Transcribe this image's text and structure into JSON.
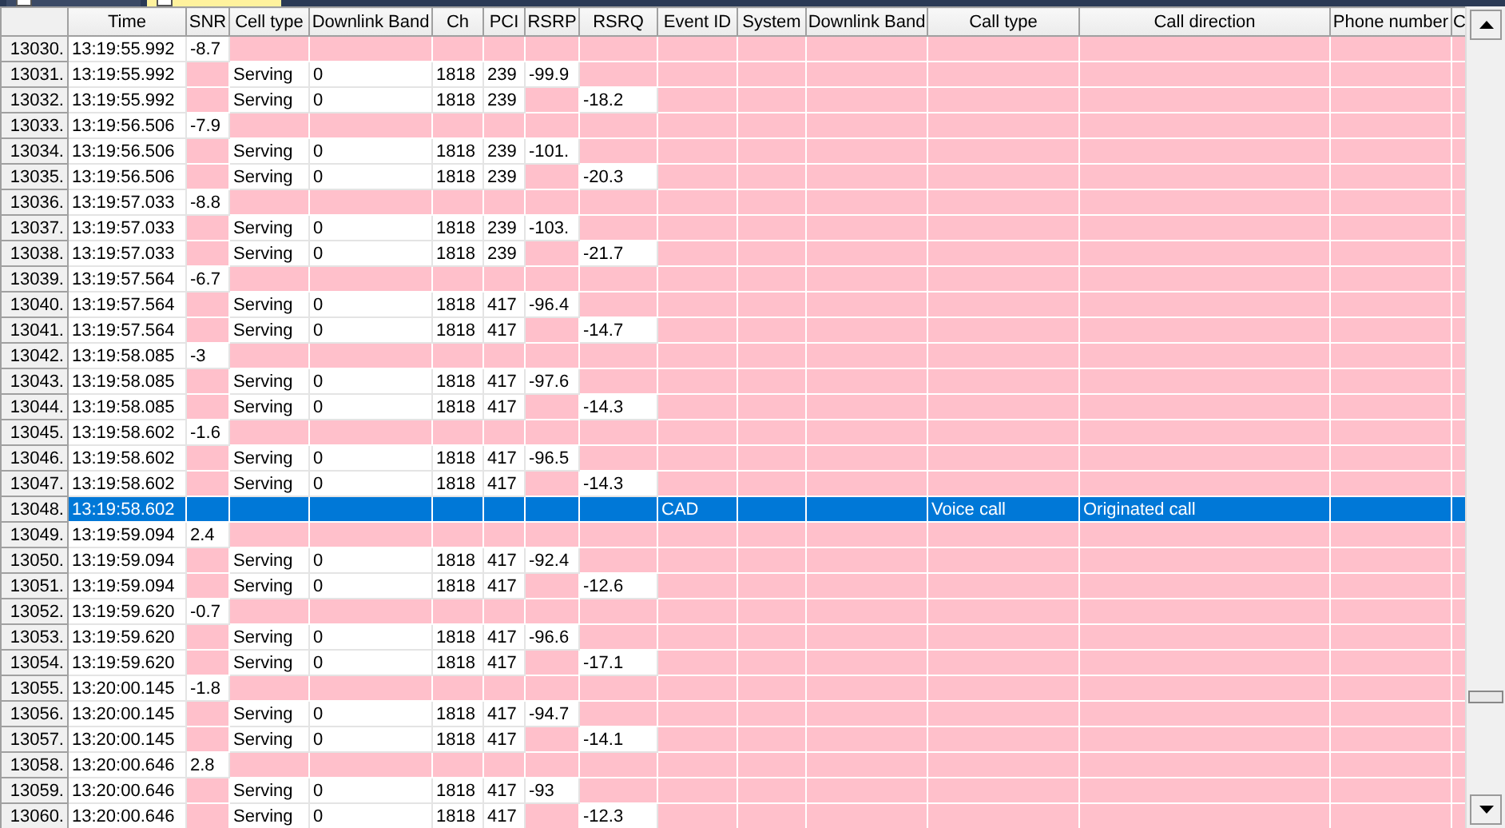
{
  "tabs": [
    {
      "selected": false
    },
    {
      "selected": true
    }
  ],
  "table": {
    "columns": [
      "Time",
      "SNR",
      "Cell type",
      "Downlink Band",
      "Ch",
      "PCI",
      "RSRP",
      "RSRQ",
      "Event ID",
      "System",
      "Downlink Band",
      "Call type",
      "Call direction",
      "Phone number",
      "C"
    ],
    "rows": [
      {
        "number": "13030.",
        "time": "13:19:55.992",
        "snr": "-8.7",
        "selected": false
      },
      {
        "number": "13031.",
        "time": "13:19:55.992",
        "cell_type": "Serving",
        "downlink_band": "0",
        "ch": "1818",
        "pci": "239",
        "rsrp": "-99.9",
        "selected": false
      },
      {
        "number": "13032.",
        "time": "13:19:55.992",
        "cell_type": "Serving",
        "downlink_band": "0",
        "ch": "1818",
        "pci": "239",
        "rsrq": "-18.2",
        "selected": false
      },
      {
        "number": "13033.",
        "time": "13:19:56.506",
        "snr": "-7.9",
        "selected": false
      },
      {
        "number": "13034.",
        "time": "13:19:56.506",
        "cell_type": "Serving",
        "downlink_band": "0",
        "ch": "1818",
        "pci": "239",
        "rsrp": "-101.",
        "selected": false
      },
      {
        "number": "13035.",
        "time": "13:19:56.506",
        "cell_type": "Serving",
        "downlink_band": "0",
        "ch": "1818",
        "pci": "239",
        "rsrq": "-20.3",
        "selected": false
      },
      {
        "number": "13036.",
        "time": "13:19:57.033",
        "snr": "-8.8",
        "selected": false
      },
      {
        "number": "13037.",
        "time": "13:19:57.033",
        "cell_type": "Serving",
        "downlink_band": "0",
        "ch": "1818",
        "pci": "239",
        "rsrp": "-103.",
        "selected": false
      },
      {
        "number": "13038.",
        "time": "13:19:57.033",
        "cell_type": "Serving",
        "downlink_band": "0",
        "ch": "1818",
        "pci": "239",
        "rsrq": "-21.7",
        "selected": false
      },
      {
        "number": "13039.",
        "time": "13:19:57.564",
        "snr": "-6.7",
        "selected": false
      },
      {
        "number": "13040.",
        "time": "13:19:57.564",
        "cell_type": "Serving",
        "downlink_band": "0",
        "ch": "1818",
        "pci": "417",
        "rsrp": "-96.4",
        "selected": false
      },
      {
        "number": "13041.",
        "time": "13:19:57.564",
        "cell_type": "Serving",
        "downlink_band": "0",
        "ch": "1818",
        "pci": "417",
        "rsrq": "-14.7",
        "selected": false
      },
      {
        "number": "13042.",
        "time": "13:19:58.085",
        "snr": "-3",
        "selected": false
      },
      {
        "number": "13043.",
        "time": "13:19:58.085",
        "cell_type": "Serving",
        "downlink_band": "0",
        "ch": "1818",
        "pci": "417",
        "rsrp": "-97.6",
        "selected": false
      },
      {
        "number": "13044.",
        "time": "13:19:58.085",
        "cell_type": "Serving",
        "downlink_band": "0",
        "ch": "1818",
        "pci": "417",
        "rsrq": "-14.3",
        "selected": false
      },
      {
        "number": "13045.",
        "time": "13:19:58.602",
        "snr": "-1.6",
        "selected": false
      },
      {
        "number": "13046.",
        "time": "13:19:58.602",
        "cell_type": "Serving",
        "downlink_band": "0",
        "ch": "1818",
        "pci": "417",
        "rsrp": "-96.5",
        "selected": false
      },
      {
        "number": "13047.",
        "time": "13:19:58.602",
        "cell_type": "Serving",
        "downlink_band": "0",
        "ch": "1818",
        "pci": "417",
        "rsrq": "-14.3",
        "selected": false
      },
      {
        "number": "13048.",
        "time": "13:19:58.602",
        "event_id": "CAD",
        "call_type": "Voice call",
        "call_direction": "Originated call",
        "selected": true
      },
      {
        "number": "13049.",
        "time": "13:19:59.094",
        "snr": "2.4",
        "selected": false
      },
      {
        "number": "13050.",
        "time": "13:19:59.094",
        "cell_type": "Serving",
        "downlink_band": "0",
        "ch": "1818",
        "pci": "417",
        "rsrp": "-92.4",
        "selected": false
      },
      {
        "number": "13051.",
        "time": "13:19:59.094",
        "cell_type": "Serving",
        "downlink_band": "0",
        "ch": "1818",
        "pci": "417",
        "rsrq": "-12.6",
        "selected": false
      },
      {
        "number": "13052.",
        "time": "13:19:59.620",
        "snr": "-0.7",
        "selected": false
      },
      {
        "number": "13053.",
        "time": "13:19:59.620",
        "cell_type": "Serving",
        "downlink_band": "0",
        "ch": "1818",
        "pci": "417",
        "rsrp": "-96.6",
        "selected": false
      },
      {
        "number": "13054.",
        "time": "13:19:59.620",
        "cell_type": "Serving",
        "downlink_band": "0",
        "ch": "1818",
        "pci": "417",
        "rsrq": "-17.1",
        "selected": false
      },
      {
        "number": "13055.",
        "time": "13:20:00.145",
        "snr": "-1.8",
        "selected": false
      },
      {
        "number": "13056.",
        "time": "13:20:00.145",
        "cell_type": "Serving",
        "downlink_band": "0",
        "ch": "1818",
        "pci": "417",
        "rsrp": "-94.7",
        "selected": false
      },
      {
        "number": "13057.",
        "time": "13:20:00.145",
        "cell_type": "Serving",
        "downlink_band": "0",
        "ch": "1818",
        "pci": "417",
        "rsrq": "-14.1",
        "selected": false
      },
      {
        "number": "13058.",
        "time": "13:20:00.646",
        "snr": "2.8",
        "selected": false
      },
      {
        "number": "13059.",
        "time": "13:20:00.646",
        "cell_type": "Serving",
        "downlink_band": "0",
        "ch": "1818",
        "pci": "417",
        "rsrp": "-93",
        "selected": false
      },
      {
        "number": "13060.",
        "time": "13:20:00.646",
        "cell_type": "Serving",
        "downlink_band": "0",
        "ch": "1818",
        "pci": "417",
        "rsrq": "-12.3",
        "selected": false
      }
    ]
  }
}
